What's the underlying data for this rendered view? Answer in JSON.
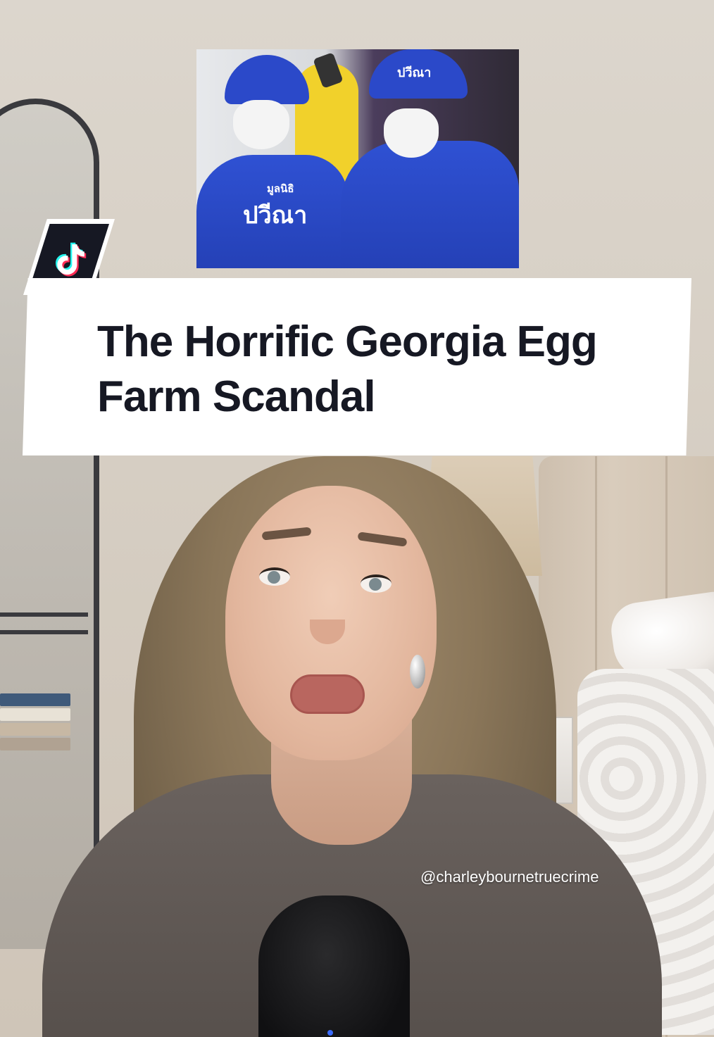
{
  "video": {
    "title_card": {
      "title": "The Horrific Georgia Egg Farm Scandal"
    },
    "watermark": {
      "handle": "@charleybournetruecrime",
      "platform_icon": "tiktok-icon"
    },
    "news_photo": {
      "left_suit_text_small": "มูลนิธิ",
      "left_suit_text_large": "ปวีณา",
      "cap_text": "ปวีณา"
    }
  },
  "colors": {
    "title_text": "#161823",
    "title_background": "#ffffff",
    "badge_background": "#161823",
    "tiktok_cyan": "#25f4ee",
    "tiktok_red": "#fe2c55"
  }
}
